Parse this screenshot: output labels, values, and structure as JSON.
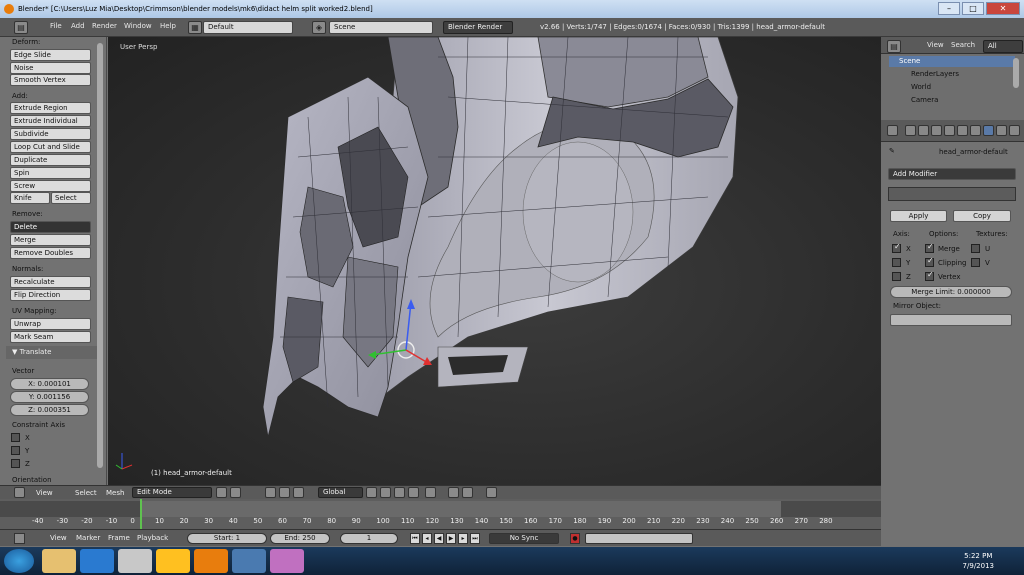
{
  "window": {
    "title": "Blender* [C:\\Users\\Luz Mia\\Desktop\\Crimmson\\blender models\\mk6\\didact helm split worked2.blend]"
  },
  "header": {
    "menus": [
      "File",
      "Add",
      "Render",
      "Window",
      "Help"
    ],
    "layout": "Default",
    "scene": "Scene",
    "engine": "Blender Render",
    "stats": "v2.66 | Verts:1/747 | Edges:0/1674 | Faces:0/930 | Tris:1399 | head_armor-default"
  },
  "toolbar": {
    "deform_label": "Deform:",
    "deform": [
      "Edge Slide",
      "Noise",
      "Smooth Vertex"
    ],
    "add_label": "Add:",
    "add": [
      "Extrude Region",
      "Extrude Individual",
      "Subdivide",
      "Loop Cut and Slide",
      "Duplicate",
      "Spin",
      "Screw"
    ],
    "knife": "Knife",
    "select": "Select",
    "remove_label": "Remove:",
    "delete": "Delete",
    "remove": [
      "Merge",
      "Remove Doubles"
    ],
    "normals_label": "Normals:",
    "normals": [
      "Recalculate",
      "Flip Direction"
    ],
    "uv_label": "UV Mapping:",
    "uv": [
      "Unwrap",
      "Mark Seam"
    ],
    "translate_title": "Translate",
    "vector_label": "Vector",
    "vector": [
      "X: 0.000101",
      "Y: 0.001156",
      "Z: 0.000351"
    ],
    "constraint_label": "Constraint Axis",
    "axes": [
      "X",
      "Y",
      "Z"
    ],
    "orientation_label": "Orientation"
  },
  "viewport": {
    "view_label": "User Persp",
    "object_label": "(1) head_armor-default"
  },
  "viewport_header": {
    "menus": [
      "View",
      "Select",
      "Mesh"
    ],
    "mode": "Edit Mode",
    "orientation": "Global"
  },
  "timeline": {
    "ticks": [
      "-40",
      "-30",
      "-20",
      "-10",
      "0",
      "10",
      "20",
      "30",
      "40",
      "50",
      "60",
      "70",
      "80",
      "90",
      "100",
      "110",
      "120",
      "130",
      "140",
      "150",
      "160",
      "170",
      "180",
      "190",
      "200",
      "210",
      "220",
      "230",
      "240",
      "250",
      "260",
      "270",
      "280"
    ],
    "menus": [
      "View",
      "Marker",
      "Frame",
      "Playback"
    ],
    "start": "Start: 1",
    "end": "End: 250",
    "current": "1",
    "sync": "No Sync"
  },
  "outliner": {
    "menus": [
      "View",
      "Search"
    ],
    "filter": "All Scenes",
    "items": [
      "Scene",
      "RenderLayers",
      "World",
      "Camera"
    ]
  },
  "properties": {
    "object": "head_armor-default",
    "add_modifier": "Add Modifier",
    "apply": "Apply",
    "copy": "Copy",
    "axis_label": "Axis:",
    "options_label": "Options:",
    "textures_label": "Textures:",
    "axes": [
      "X",
      "Y",
      "Z"
    ],
    "options": [
      "Merge",
      "Clipping",
      "Vertex"
    ],
    "textures": [
      "U",
      "V"
    ],
    "merge_limit": "Merge Limit: 0.000000",
    "mirror_object": "Mirror Object:"
  },
  "taskbar": {
    "time": "5:22 PM",
    "date": "7/9/2013"
  }
}
